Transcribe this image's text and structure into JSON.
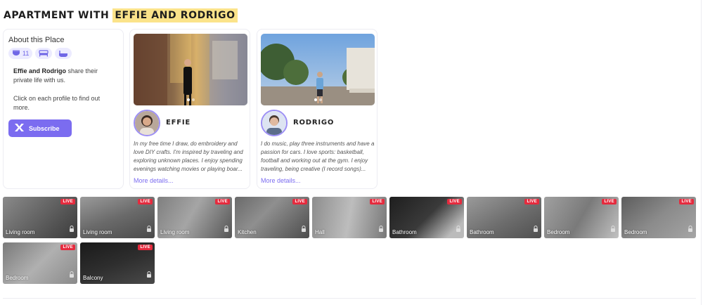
{
  "header": {
    "title_prefix": "APARTMENT WITH",
    "title_highlight": "EFFIE AND RODRIGO"
  },
  "about": {
    "title": "About this Place",
    "amenities": [
      {
        "icon": "toilet-icon",
        "count": "11"
      },
      {
        "icon": "bed-icon"
      },
      {
        "icon": "bathtub-icon"
      }
    ],
    "desc_names": "Effie and Rodrigo",
    "desc_rest": " share their private life with us.",
    "hint": "Click on each profile to find out more.",
    "subscribe_label": "Subscribe"
  },
  "profiles": [
    {
      "name": "EFFIE",
      "bio": "In my free time I draw, do embroidery and love DIY crafts. I'm inspired by traveling and exploring unknown places. I enjoy spending evenings watching movies or playing boar...",
      "more_label": "More details..."
    },
    {
      "name": "RODRIGO",
      "bio": "I do music, play three instruments and have a passion for cars. I love sports: basketball, football and working out at the gym. I enjoy traveling, being creative (I record songs)...",
      "more_label": "More details..."
    }
  ],
  "cameras": [
    {
      "room": "Living room",
      "badge": "LIVE"
    },
    {
      "room": "Living room",
      "badge": "LIVE"
    },
    {
      "room": "Living room",
      "badge": "LIVE"
    },
    {
      "room": "Kitchen",
      "badge": "LIVE"
    },
    {
      "room": "Hall",
      "badge": "LIVE"
    },
    {
      "room": "Bathroom",
      "badge": "LIVE"
    },
    {
      "room": "Bathroom",
      "badge": "LIVE"
    },
    {
      "room": "Bedroom",
      "badge": "LIVE"
    },
    {
      "room": "Bedroom",
      "badge": "LIVE"
    },
    {
      "room": "Bedroom",
      "badge": "LIVE"
    },
    {
      "room": "Balcony",
      "badge": "LIVE"
    }
  ],
  "colors": {
    "accent": "#7b6cf0",
    "highlight": "#fbe38a",
    "live": "#e52b3e"
  }
}
